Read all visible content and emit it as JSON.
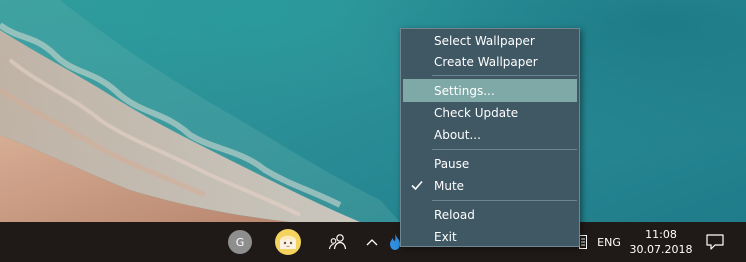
{
  "context_menu": {
    "items": [
      {
        "label": "Select Wallpaper",
        "checked": false,
        "highlighted": false
      },
      {
        "label": "Create Wallpaper",
        "checked": false,
        "highlighted": false
      },
      {
        "label": "Settings...",
        "checked": false,
        "highlighted": true
      },
      {
        "label": "Check Update",
        "checked": false,
        "highlighted": false
      },
      {
        "label": "About...",
        "checked": false,
        "highlighted": false
      },
      {
        "label": "Pause",
        "checked": false,
        "highlighted": false
      },
      {
        "label": "Mute",
        "checked": true,
        "highlighted": false
      },
      {
        "label": "Reload",
        "checked": false,
        "highlighted": false
      },
      {
        "label": "Exit",
        "checked": false,
        "highlighted": false
      }
    ]
  },
  "taskbar": {
    "account_initial": "G",
    "language": "ENG",
    "time": "11:08",
    "date": "30.07.2018"
  },
  "icons": {
    "account": "account-circle-icon",
    "app": "anime-avatar-icon",
    "people": "people-icon",
    "overflow": "chevron-up-icon",
    "wallpaper_app": "flame-icon",
    "keyboard": "keyboard-icon",
    "notifications": "notification-icon"
  },
  "colors": {
    "menu_background": "#3f5864",
    "menu_highlight": "#7fa9a6",
    "taskbar_background": "#1f1a18",
    "water": "#2b8f97",
    "sand": "#c59a84"
  }
}
